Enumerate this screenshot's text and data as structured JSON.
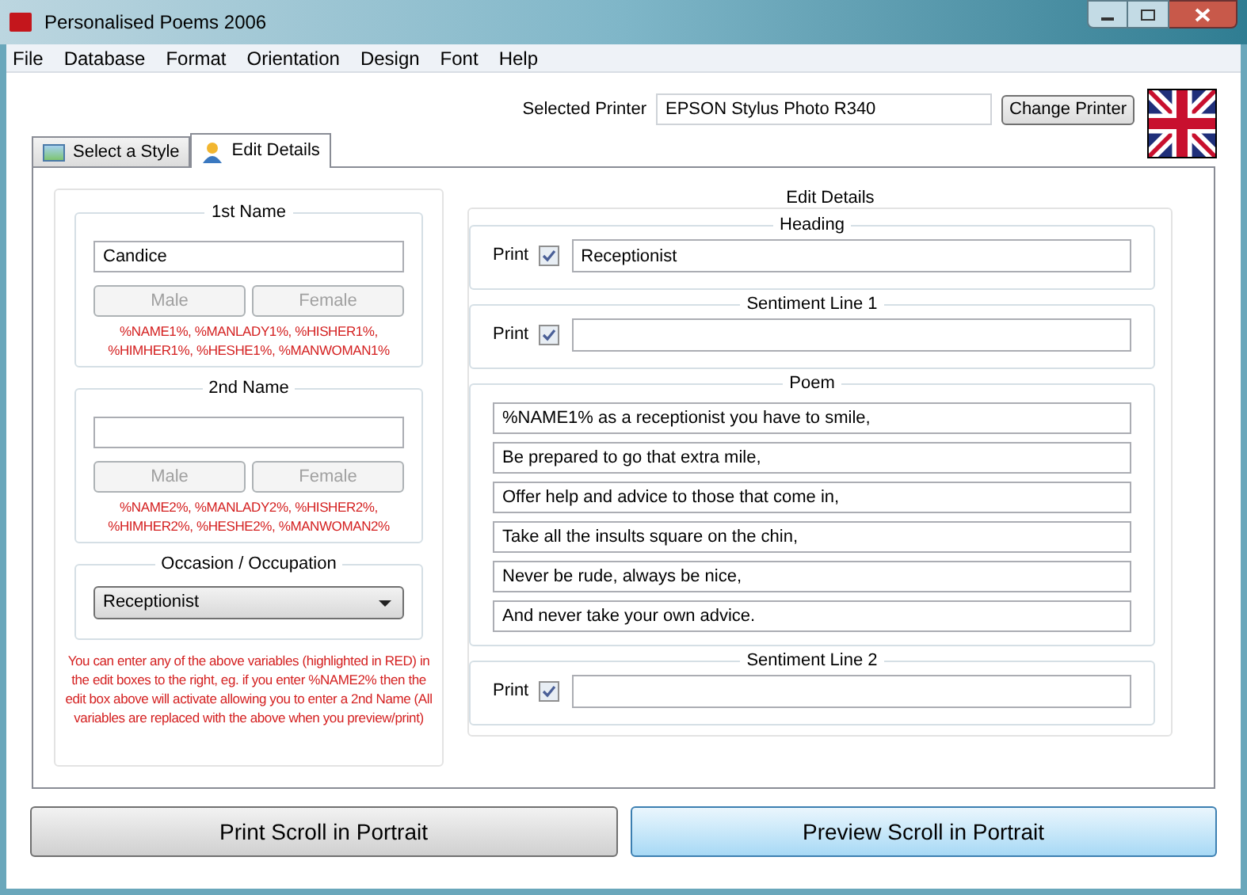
{
  "window": {
    "title": "Personalised Poems 2006"
  },
  "menu": [
    "File",
    "Database",
    "Format",
    "Orientation",
    "Design",
    "Font",
    "Help"
  ],
  "printer": {
    "label": "Selected Printer",
    "value": "EPSON Stylus Photo R340",
    "button": "Change Printer"
  },
  "tabs": [
    {
      "label": "Select a Style",
      "selected": false,
      "kind": "style"
    },
    {
      "label": "Edit Details",
      "selected": true,
      "kind": "person"
    }
  ],
  "names": [
    {
      "title": "1st Name",
      "value": "Candice",
      "buttons": [
        {
          "label": "Male",
          "disabled": true
        },
        {
          "label": "Female",
          "disabled": true
        }
      ],
      "variables": "%NAME1%, %MANLADY1%, %HISHER1%, %HIMHER1%, %HESHE1%, %MANWOMAN1%"
    },
    {
      "title": "2nd Name",
      "buttons": [
        {
          "label": "Male",
          "disabled": true
        },
        {
          "label": "Female",
          "disabled": true
        }
      ],
      "variables": "%NAME2%, %MANLADY2%, %HISHER2%, %HIMHER2%, %HESHE2%, %MANWOMAN2%"
    }
  ],
  "occasion": {
    "title": "Occasion / Occupation",
    "value": "Receptionist"
  },
  "note": "You can enter any of the above variables (highlighted in RED) in the edit boxes to the right, eg. if you enter %NAME2% then the edit box above will activate allowing you to enter a 2nd Name (All variables are replaced with the above when you preview/print)",
  "edit_details": {
    "title": "Edit Details",
    "sections": [
      {
        "kind": "field",
        "title": "Heading",
        "print_label": "Print",
        "checked": true,
        "value": "Receptionist"
      },
      {
        "kind": "field",
        "title": "Sentiment Line 1",
        "print_label": "Print",
        "checked": true
      },
      {
        "kind": "poem",
        "title": "Poem",
        "lines": [
          "%NAME1% as a receptionist you have to smile,",
          "Be prepared to go that extra mile,",
          "Offer help and advice to those that come in,",
          "Take all the insults square on the chin,",
          "Never be rude, always be nice,",
          "And never take your own advice."
        ]
      },
      {
        "kind": "field",
        "title": "Sentiment Line 2",
        "print_label": "Print",
        "checked": true
      }
    ]
  },
  "buttons": [
    {
      "label": "Print Scroll in Portrait",
      "focused": false
    },
    {
      "label": "Preview Scroll in Portrait",
      "focused": true
    }
  ]
}
